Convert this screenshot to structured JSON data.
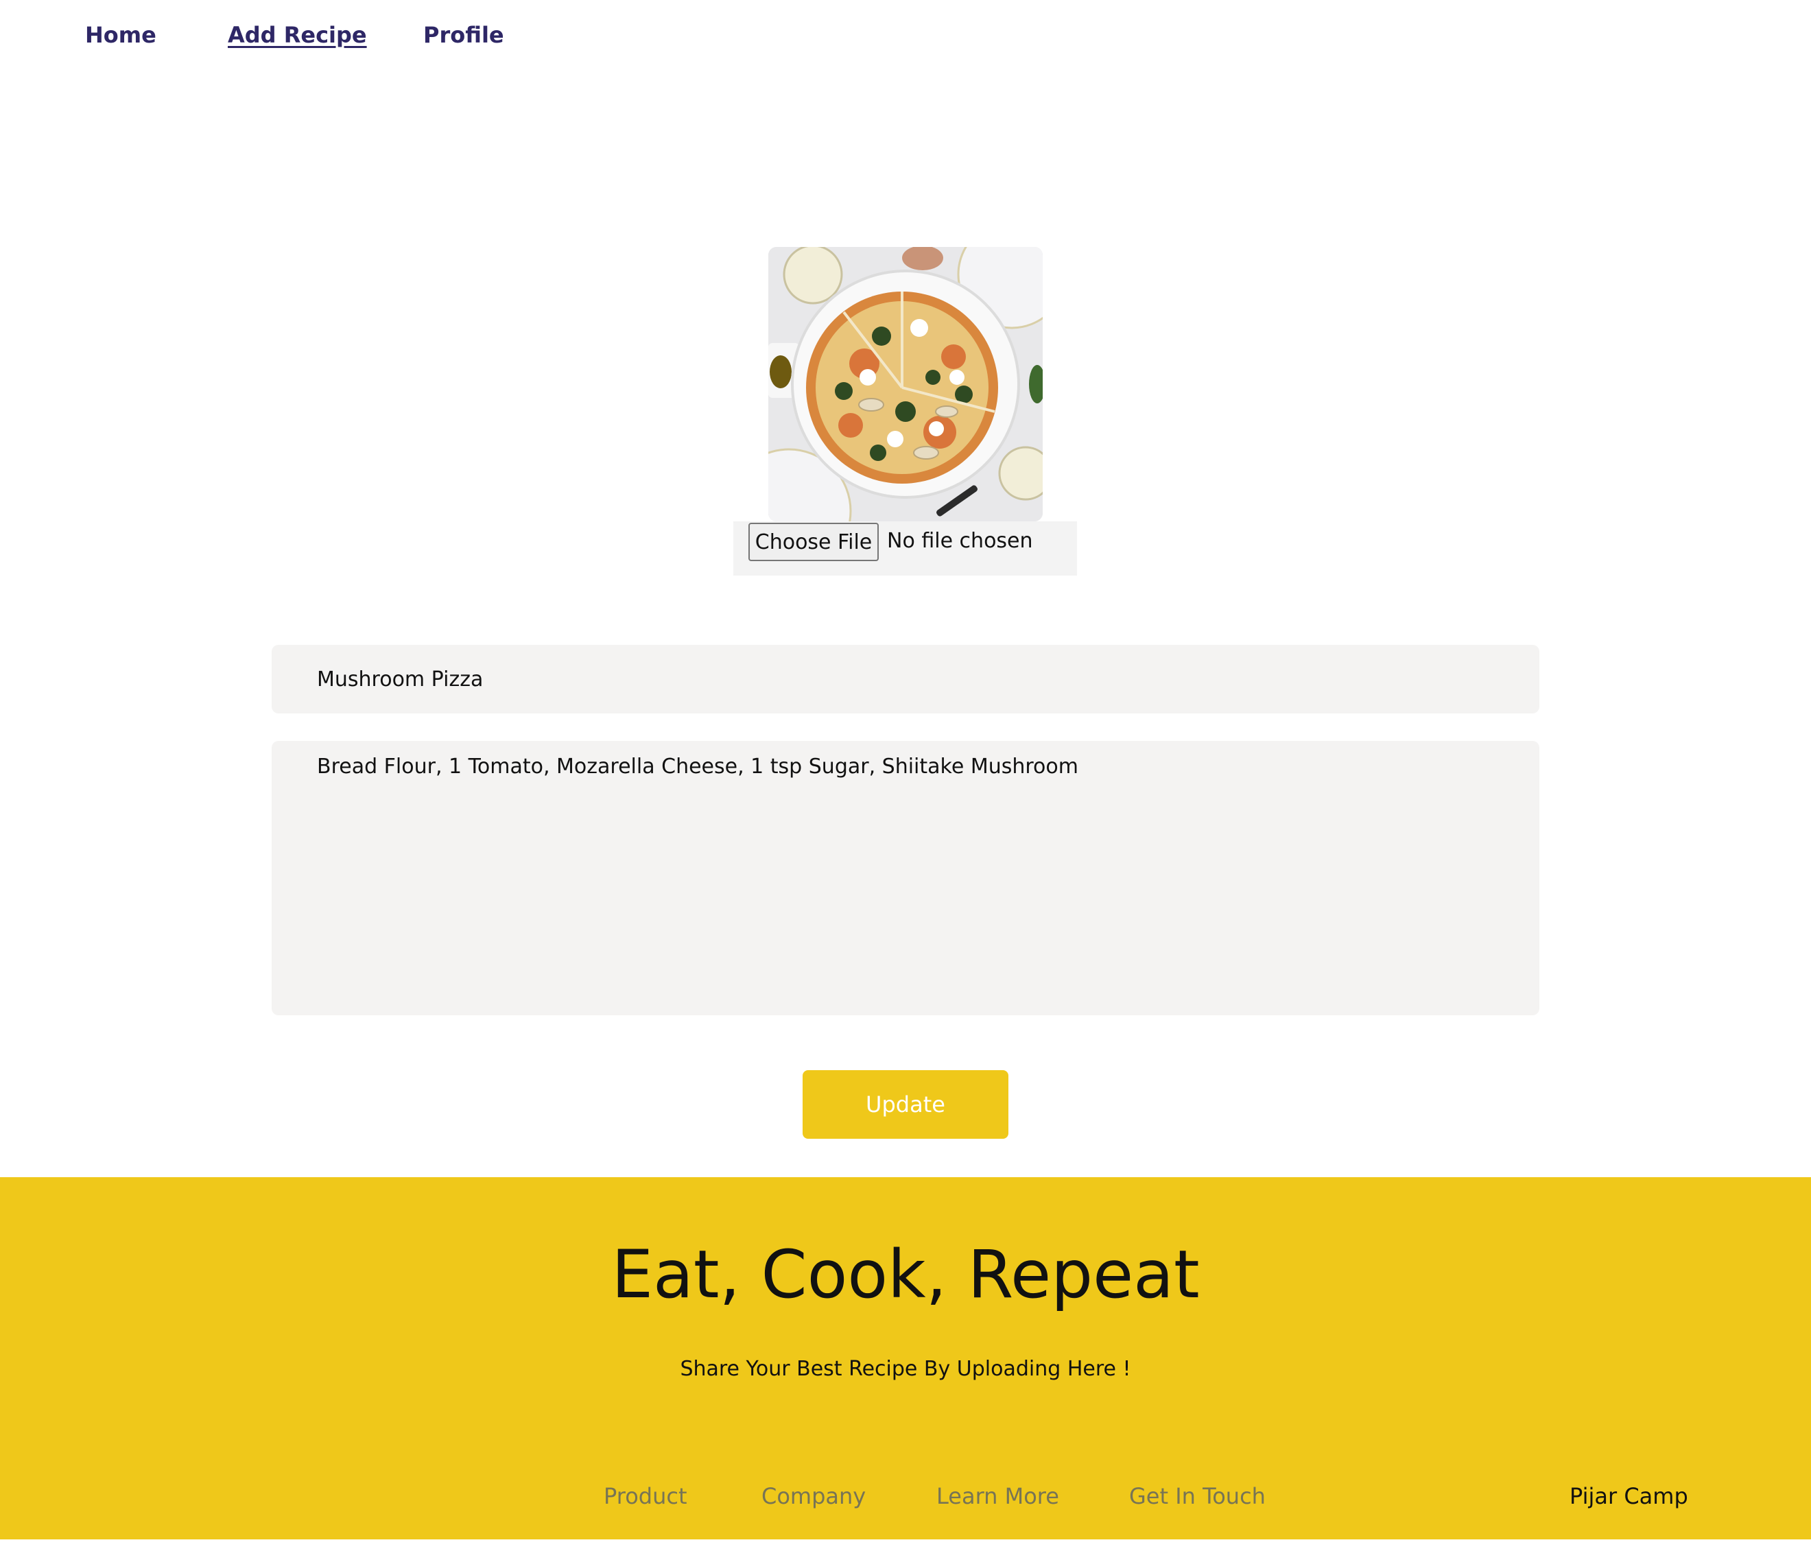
{
  "nav": {
    "items": [
      {
        "label": "Home"
      },
      {
        "label": "Add Recipe"
      },
      {
        "label": "Profile"
      }
    ],
    "active": "Add Recipe"
  },
  "upload": {
    "photo_subject": "pizza-photo",
    "choose_label": "Choose File",
    "status": "No file chosen"
  },
  "form": {
    "title_value": "Mushroom Pizza",
    "ingredients_value": "Bread Flour, 1 Tomato, Mozarella Cheese, 1 tsp Sugar, Shiitake Mushroom",
    "update_label": "Update"
  },
  "footer": {
    "title": "Eat, Cook, Repeat",
    "subtitle": "Share Your Best Recipe By Uploading Here !",
    "links": [
      "Product",
      "Company",
      "Learn More",
      "Get In Touch"
    ],
    "brand": "Pijar Camp"
  },
  "colors": {
    "accent": "#efc81a",
    "nav_text": "#2e2766",
    "field_bg": "#f4f3f2",
    "footer_link": "#777455"
  }
}
